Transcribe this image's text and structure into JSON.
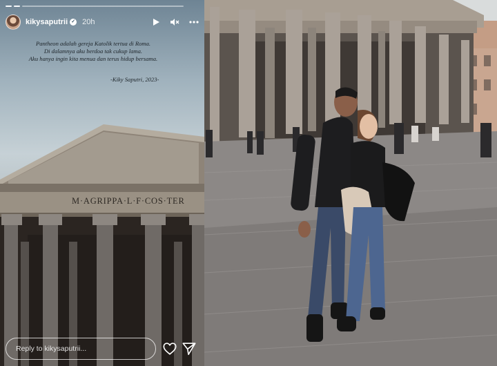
{
  "story": {
    "username": "kikysaputrii",
    "time_ago": "20h",
    "verified_icon": "verified-badge-icon",
    "caption_lines": [
      "Pantheon adalah gereja Katolik tertua di Roma.",
      "Di dalamnya aku berdoa tak cukup lama.",
      "Aku hanya ingin kita menua dan terus hidup bersama."
    ],
    "signature": "-Kiky Saputri, 2023-",
    "controls": {
      "play_icon": "play-icon",
      "mute_icon": "mute-icon",
      "more_icon": "more-options-icon"
    },
    "reply_placeholder": "Reply to kikysaputrii...",
    "like_icon": "heart-icon",
    "share_icon": "send-icon",
    "progress_segments": 2
  },
  "image": {
    "inscription": "M·AGRIPPA·L·F·COS·TER"
  }
}
